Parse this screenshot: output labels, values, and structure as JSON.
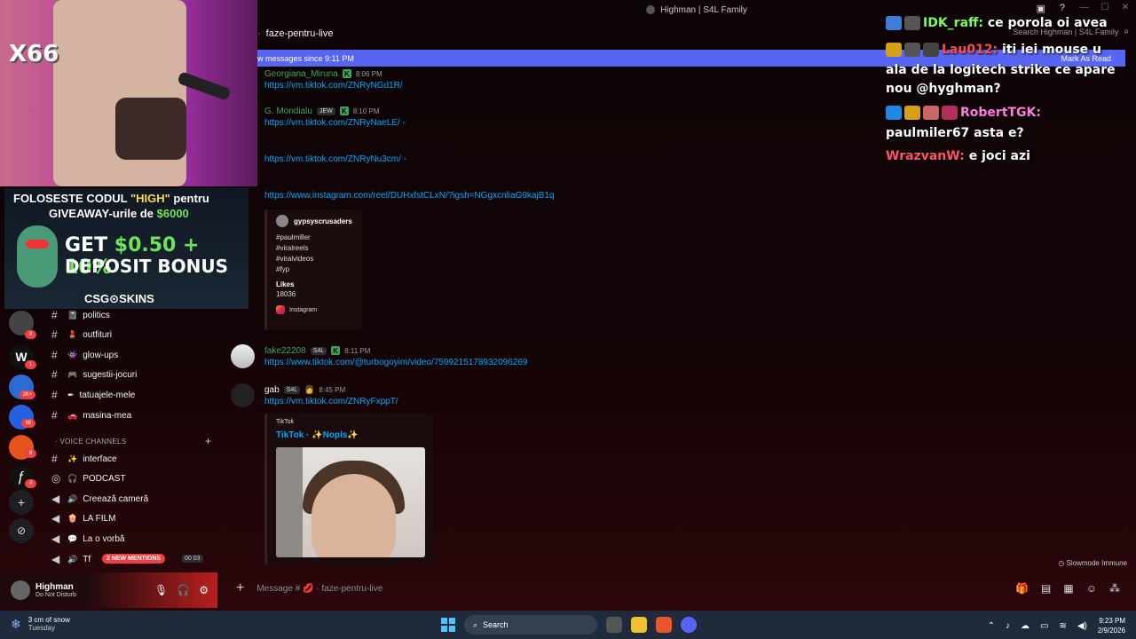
{
  "window": {
    "title": "Highman | S4L Family"
  },
  "channel": {
    "name": "faze-pentru-live",
    "search_placeholder": "Search Highman | S4L Family"
  },
  "new_messages_bar": {
    "text": "w messages since 9:11 PM",
    "mark_as_read": "Mark As Read"
  },
  "messages": [
    {
      "author": "Georgiana_Miruna",
      "time": "8:06 PM",
      "color": "#3ba55c",
      "links": [
        "https://vm.tiktok.com/ZNRyNGd1R/"
      ]
    },
    {
      "author": "G. Mondialu",
      "tag": "JEW",
      "time": "8:10 PM",
      "color": "#3ba55c",
      "links": [
        "https://vm.tiktok.com/ZNRyNaeLE/ -",
        "https://vm.tiktok.com/ZNRyNu3cm/ -",
        "https://www.instagram.com/reel/DUHxfstCLxN/?igsh=NGgxcnliaG9kajB1q"
      ]
    },
    {
      "author": "fake22208",
      "tag": "S4L",
      "time": "8:11 PM",
      "color": "#3ba55c",
      "links": [
        "https://www.tiktok.com/@turbogoyim/video/7599215178932096269"
      ]
    },
    {
      "author": "gab",
      "tag": "S4L",
      "time": "8:45 PM",
      "color": "#f2f3f5",
      "links": [
        "https://vm.tiktok.com/ZNRyFxppT/"
      ]
    }
  ],
  "instagram_embed": {
    "author": "gypsyscrusaders",
    "tags": [
      "#paulmiller",
      "#viralreels",
      "#viralvideos",
      "#fyp"
    ],
    "field_name": "Likes",
    "field_value": "18036",
    "footer": "Instagram"
  },
  "tiktok_embed": {
    "provider": "TikTok",
    "title": "TikTok · ✨Nopls✨"
  },
  "sidebar": {
    "channels": [
      {
        "emoji": "📓",
        "label": "politics"
      },
      {
        "emoji": "💄",
        "label": "outfituri"
      },
      {
        "emoji": "👾",
        "label": "glow-ups"
      },
      {
        "emoji": "🎮",
        "label": "sugestii-jocuri"
      },
      {
        "emoji": "✒",
        "label": "tatuajele-mele"
      },
      {
        "emoji": "🚗",
        "label": "masina-mea"
      }
    ],
    "voice_header": "VOICE CHANNELS",
    "voice_channels": [
      {
        "emoji": "✨",
        "label": "interface"
      },
      {
        "emoji": "🎧",
        "label": "PODCAST"
      },
      {
        "emoji": "🔊",
        "label": "Creează cameră"
      },
      {
        "emoji": "🍿",
        "label": "LA FILM"
      },
      {
        "emoji": "💬",
        "label": "La o vorbă"
      },
      {
        "emoji": "🔊",
        "label": "Tf"
      }
    ],
    "mentions_pill": "2 NEW MENTIONS",
    "vc_count_a": "00",
    "vc_count_b": "03",
    "server_badges": [
      "8",
      "1",
      "2K+",
      "68",
      "8",
      "4"
    ]
  },
  "user_panel": {
    "name": "Highman",
    "status": "Do Not Disturb"
  },
  "composer": {
    "placeholder": "Message # 💋 · faze-pentru-live"
  },
  "slowmode": "Slowmode Immune",
  "overlay": {
    "webcam_label": "X66",
    "promo_line1_a": "FOLOSESTE CODUL ",
    "promo_line1_b": "\"HIGH\"",
    "promo_line1_c": " pentru",
    "promo_line2_a": "GIVEAWAY-urile de ",
    "promo_line2_b": "$6000",
    "promo_big1_a": "GET ",
    "promo_big1_b": "$0.50 + 10%",
    "promo_big2": "DEPOSIT BONUS",
    "promo_brand": "CSG⊙SKINS"
  },
  "chat": [
    {
      "user": "IDK_raff:",
      "text": " ce porola oi avea",
      "user_color": "#7cff57"
    },
    {
      "user": "Lau012:",
      "text": " iti iei mouse u",
      "user_color": "#ff4d4d"
    },
    {
      "user": "",
      "text": "ala de la logitech strike ce apare",
      "user_color": "#ffffff"
    },
    {
      "user": "",
      "text": "nou @hyghman?",
      "user_color": "#ffffff"
    },
    {
      "user": "RobertTGK:",
      "text": "",
      "user_color": "#ff7de0"
    },
    {
      "user": "",
      "text": "paulmiler67 asta e?",
      "user_color": "#ffffff"
    },
    {
      "user": "WrazvanW:",
      "text": " e joci azi",
      "user_color": "#ff5566"
    }
  ],
  "taskbar": {
    "weather_line1": "3 cm of snow",
    "weather_line2": "Tuesday",
    "search_label": "Search",
    "time": "9:23 PM",
    "date": "2/9/2026"
  }
}
